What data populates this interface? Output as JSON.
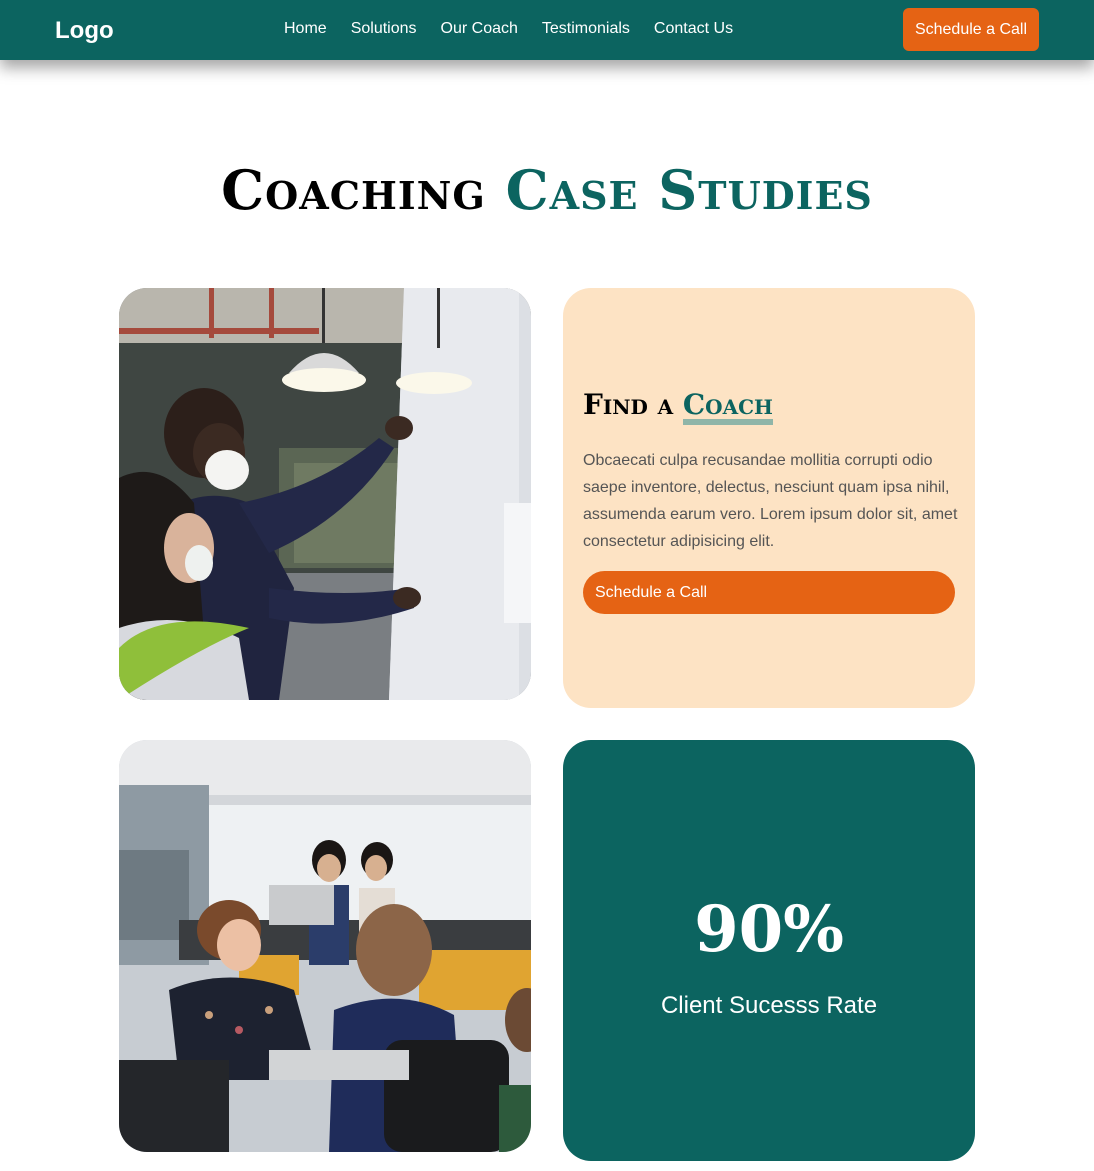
{
  "nav": {
    "logo": "Logo",
    "links": [
      "Home",
      "Solutions",
      "Our Coach",
      "Testimonials",
      "Contact Us"
    ],
    "cta": "Schedule a Call"
  },
  "hero": {
    "title_plain": "Coaching",
    "title_highlight": "Case Studies"
  },
  "find_coach": {
    "heading_plain": "Find a",
    "heading_highlight": "Coach",
    "body": "Obcaecati culpa recusandae mollitia corrupti odio saepe inventore, delectus, nesciunt quam ipsa nihil, assumenda earum vero. Lorem ipsum dolor sit, amet consectetur adipisicing elit.",
    "cta": "Schedule a Call"
  },
  "stat": {
    "value": "90%",
    "label": "Client Sucesss Rate"
  },
  "colors": {
    "brand_teal": "#0c6460",
    "accent_orange": "#e56314",
    "peach": "#fde3c4",
    "highlight_bar": "#9bbfbb"
  },
  "images": [
    "people-whiteboard-photo",
    "office-team-photo"
  ]
}
